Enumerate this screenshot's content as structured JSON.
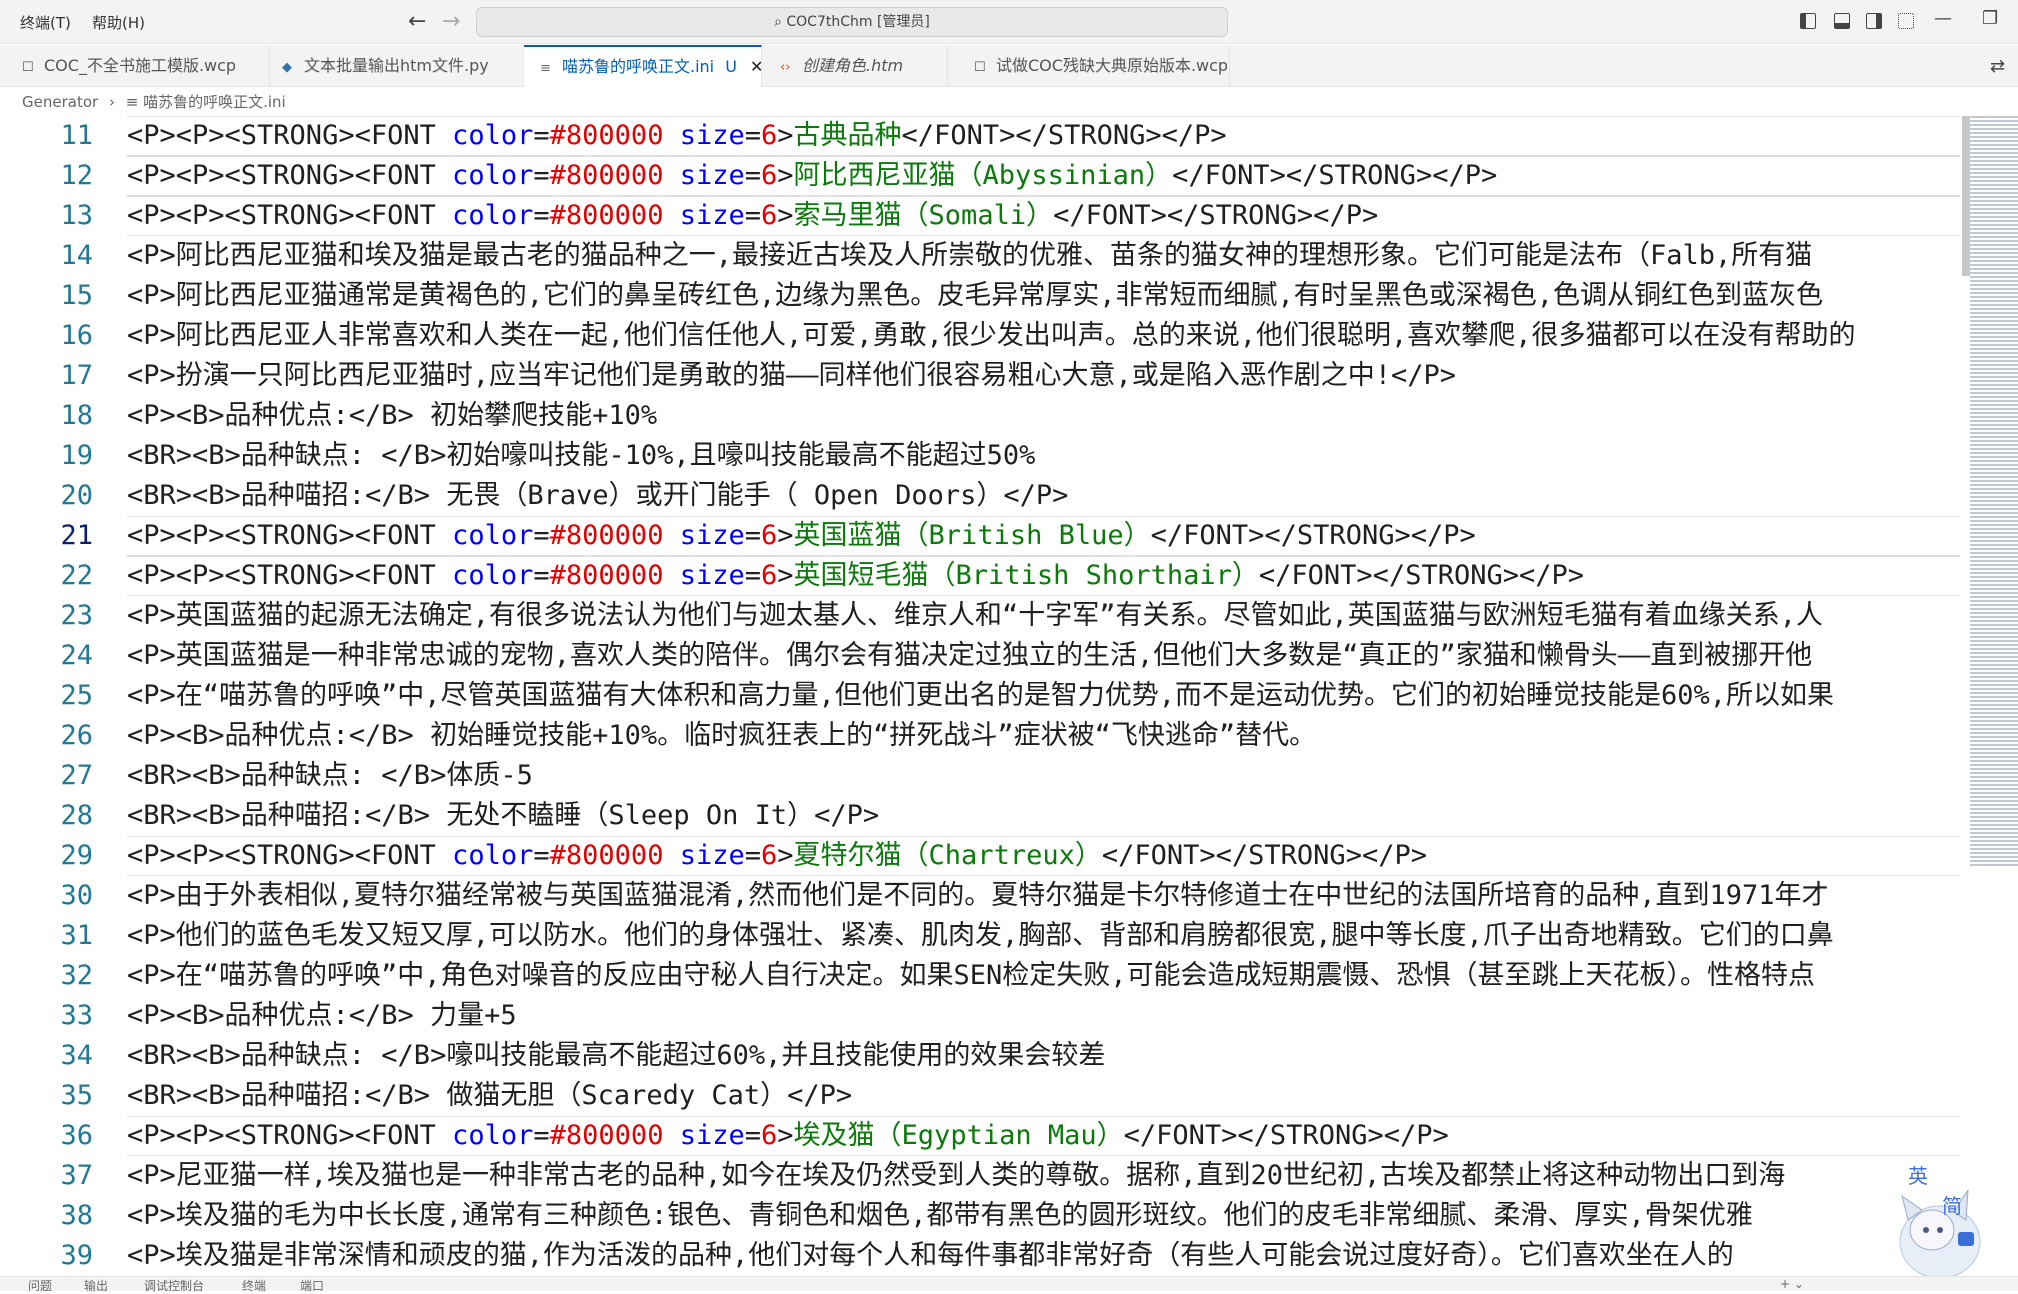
{
  "menu": {
    "terminal": "终端(T)",
    "help": "帮助(H)"
  },
  "command_center": "COC7thChm [管理员]",
  "tabs": [
    {
      "label": "COC_不全书施工模版.wcp",
      "icon": "file-icon"
    },
    {
      "label": "文本批量输出htm文件.py",
      "icon": "python-icon"
    },
    {
      "label": "喵苏鲁的呼唤正文.ini",
      "icon": "ini-icon",
      "badge": "U",
      "active": true
    },
    {
      "label": "创建角色.htm",
      "icon": "html-icon"
    },
    {
      "label": "试做COC残缺大典原始版本.wcp",
      "icon": "file-icon"
    }
  ],
  "breadcrumb": {
    "folder": "Generator",
    "file": "喵苏鲁的呼唤正文.ini"
  },
  "lines": [
    {
      "n": "11",
      "t": "<P><P><STRONG><FONT color=#800000 size=6>古典品种</FONT></STRONG></P>"
    },
    {
      "n": "12",
      "t": "<P><P><STRONG><FONT color=#800000 size=6>阿比西尼亚猫（Abyssinian）</FONT></STRONG></P>"
    },
    {
      "n": "13",
      "t": "<P><P><STRONG><FONT color=#800000 size=6>索马里猫（Somali）</FONT></STRONG></P>"
    },
    {
      "n": "14",
      "t": "<P>阿比西尼亚猫和埃及猫是最古老的猫品种之一,最接近古埃及人所崇敬的优雅、苗条的猫女神的理想形象。它们可能是法布（Falb,所有猫"
    },
    {
      "n": "15",
      "t": "<P>阿比西尼亚猫通常是黄褐色的,它们的鼻呈砖红色,边缘为黑色。皮毛异常厚实,非常短而细腻,有时呈黑色或深褐色,色调从铜红色到蓝灰色"
    },
    {
      "n": "16",
      "t": "<P>阿比西尼亚人非常喜欢和人类在一起,他们信任他人,可爱,勇敢,很少发出叫声。总的来说,他们很聪明,喜欢攀爬,很多猫都可以在没有帮助的"
    },
    {
      "n": "17",
      "t": "<P>扮演一只阿比西尼亚猫时,应当牢记他们是勇敢的猫——同样他们很容易粗心大意,或是陷入恶作剧之中!</P>"
    },
    {
      "n": "18",
      "t": "<P><B>品种优点:</B> 初始攀爬技能+10%"
    },
    {
      "n": "19",
      "t": "<BR><B>品种缺点: </B>初始嚎叫技能-10%,且嚎叫技能最高不能超过50%"
    },
    {
      "n": "20",
      "t": "<BR><B>品种喵招:</B> 无畏（Brave）或开门能手（ Open Doors）</P>"
    },
    {
      "n": "21",
      "t": "<P><P><STRONG><FONT color=#800000 size=6>英国蓝猫（British Blue）</FONT></STRONG></P>"
    },
    {
      "n": "22",
      "t": "<P><P><STRONG><FONT color=#800000 size=6>英国短毛猫（British Shorthair）</FONT></STRONG></P>"
    },
    {
      "n": "23",
      "t": "<P>英国蓝猫的起源无法确定,有很多说法认为他们与迦太基人、维京人和“十字军”有关系。尽管如此,英国蓝猫与欧洲短毛猫有着血缘关系,人"
    },
    {
      "n": "24",
      "t": "<P>英国蓝猫是一种非常忠诚的宠物,喜欢人类的陪伴。偶尔会有猫决定过独立的生活,但他们大多数是“真正的”家猫和懒骨头——直到被挪开他"
    },
    {
      "n": "25",
      "t": "<P>在“喵苏鲁的呼唤”中,尽管英国蓝猫有大体积和高力量,但他们更出名的是智力优势,而不是运动优势。它们的初始睡觉技能是60%,所以如果"
    },
    {
      "n": "26",
      "t": "<P><B>品种优点:</B> 初始睡觉技能+10%。临时疯狂表上的“拼死战斗”症状被“飞快逃命”替代。"
    },
    {
      "n": "27",
      "t": "<BR><B>品种缺点: </B>体质-5"
    },
    {
      "n": "28",
      "t": "<BR><B>品种喵招:</B> 无处不瞌睡（Sleep On It）</P>"
    },
    {
      "n": "29",
      "t": "<P><P><STRONG><FONT color=#800000 size=6>夏特尔猫（Chartreux）</FONT></STRONG></P>"
    },
    {
      "n": "30",
      "t": "<P>由于外表相似,夏特尔猫经常被与英国蓝猫混淆,然而他们是不同的。夏特尔猫是卡尔特修道士在中世纪的法国所培育的品种,直到1971年才"
    },
    {
      "n": "31",
      "t": "<P>他们的蓝色毛发又短又厚,可以防水。他们的身体强壮、紧凑、肌肉发,胸部、背部和肩膀都很宽,腿中等长度,爪子出奇地精致。它们的口鼻"
    },
    {
      "n": "32",
      "t": "<P>在“喵苏鲁的呼唤”中,角色对噪音的反应由守秘人自行决定。如果SEN检定失败,可能会造成短期震慑、恐惧（甚至跳上天花板）。性格特点"
    },
    {
      "n": "33",
      "t": "<P><B>品种优点:</B> 力量+5"
    },
    {
      "n": "34",
      "t": "<BR><B>品种缺点: </B>嚎叫技能最高不能超过60%,并且技能使用的效果会较差"
    },
    {
      "n": "35",
      "t": "<BR><B>品种喵招:</B> 做猫无胆（Scaredy Cat）</P>"
    },
    {
      "n": "36",
      "t": "<P><P><STRONG><FONT color=#800000 size=6>埃及猫（Egyptian Mau）</FONT></STRONG></P>"
    },
    {
      "n": "37",
      "t": "<P>尼亚猫一样,埃及猫也是一种非常古老的品种,如今在埃及仍然受到人类的尊敬。据称,直到20世纪初,古埃及都禁止将这种动物出口到海"
    },
    {
      "n": "38",
      "t": "<P>埃及猫的毛为中长长度,通常有三种颜色:银色、青铜色和烟色,都带有黑色的圆形斑纹。他们的皮毛非常细腻、柔滑、厚实,骨架优雅"
    },
    {
      "n": "39",
      "t": "<P>埃及猫是非常深情和顽皮的猫,作为活泼的品种,他们对每个人和每件事都非常好奇（有些人可能会说过度好奇）。它们喜欢坐在人的"
    }
  ],
  "panel_tabs": [
    "问题",
    "输出",
    "调试控制台",
    "终端",
    "端口"
  ],
  "ime": {
    "mode": "英",
    "script": "简"
  },
  "colors": {
    "accent": "#005fb8",
    "tag_attr": "#e50000",
    "font_text": "#098658",
    "line_number": "#237893"
  }
}
